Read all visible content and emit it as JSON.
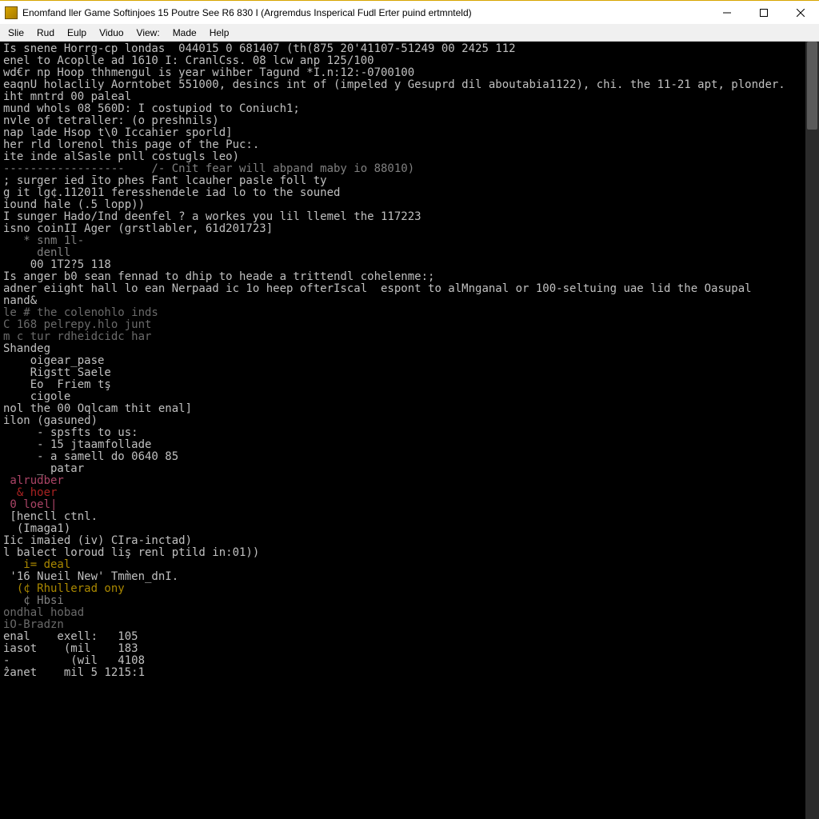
{
  "window": {
    "title": "Enomfand ller Game Softinjoes 15 Poutre See R6 830 I  (Argremdus Insperical Fudl Erter puind ertmnteld)"
  },
  "menu": {
    "items": [
      "Slie",
      "Rud",
      "Eulp",
      "Viduo",
      "View:",
      "Made",
      "Help"
    ]
  },
  "terminal": {
    "lines": [
      {
        "cls": "c-gray",
        "text": "Is snene Horrg-cp londas  044015 0 681407 (th(875 20'41107-51249 00 2425 112"
      },
      {
        "cls": "c-gray",
        "text": "enel to Acoplle ad 1610 I: CranlCss. 08 lcw anp 125/100"
      },
      {
        "cls": "c-gray",
        "text": "wd€r np Hoop thhmengul is year wihber Tagund *I.n:12:-0700100"
      },
      {
        "cls": "c-gray",
        "text": "eaqnU holaclily Aorntobet 551000, desincs int of (impeled y Gesuprd dil aboutabia1122), chi. the 11-21 apt, plonder."
      },
      {
        "cls": "c-gray",
        "text": ""
      },
      {
        "cls": "c-gray",
        "text": "iht mntrd 00 paleal"
      },
      {
        "cls": "c-gray",
        "text": "mund whols 08 560D: I costupiod to Coniuch1;"
      },
      {
        "cls": "c-gray",
        "text": "nvle of tetraller: (o preshnils)"
      },
      {
        "cls": "c-gray",
        "text": "nap lade Hsop t\\0 Iccahier sporld]"
      },
      {
        "cls": "c-gray",
        "text": "her rld lorenol this page of the Puc:."
      },
      {
        "cls": "c-gray",
        "text": ""
      },
      {
        "cls": "c-gray",
        "text": "ite inde alSasle pnll costugls leo)"
      },
      {
        "cls": "c-dim",
        "text": "------------------    /- Cnit fear will abpand maby io 88010)"
      },
      {
        "cls": "c-gray",
        "text": "; surger ied īto phes Fant lcauher pasle foll ty"
      },
      {
        "cls": "c-gray",
        "text": "g it lg¢.112011 feresshendele iad lo to the souned"
      },
      {
        "cls": "c-gray",
        "text": "iound hale (.5 lopp))"
      },
      {
        "cls": "c-gray",
        "text": "I sunger Hado/Ind deenfel ? a workes you lil llemel the 117223"
      },
      {
        "cls": "c-gray",
        "text": "isno coinII Ager (grstlabler, 61d201723]"
      },
      {
        "cls": "c-dim",
        "text": "   * snm 1l-"
      },
      {
        "cls": "c-dim",
        "text": "     denll"
      },
      {
        "cls": "c-gray",
        "text": "    00 1T2?5 118"
      },
      {
        "cls": "c-gray",
        "text": ""
      },
      {
        "cls": "c-gray",
        "text": ""
      },
      {
        "cls": "c-gray",
        "text": "Is anger b0 sean fennad to dhip to heade a trittendl cohelenme:;"
      },
      {
        "cls": "c-gray",
        "text": "adner eiight hall lo ean Nerpaad ic 1o heep ofterIscal  espont to alMnganal or 100-seltuing uae lid the Oasupal"
      },
      {
        "cls": "c-gray",
        "text": ""
      },
      {
        "cls": "c-gray",
        "text": "nand&"
      },
      {
        "cls": "c-gray",
        "text": ""
      },
      {
        "cls": "c-gray",
        "text": ""
      },
      {
        "cls": "c-cmt",
        "text": "le # the colenohlo inds"
      },
      {
        "cls": "c-cmt",
        "text": "C 168 pelrepy.hlo junt"
      },
      {
        "cls": "c-cmt",
        "text": "m c tur rdheidcidc har"
      },
      {
        "cls": "c-gray",
        "text": "Shandeg"
      },
      {
        "cls": "c-gray",
        "text": "    oigear_pase"
      },
      {
        "cls": "c-gray",
        "text": "    Rigstt Saele"
      },
      {
        "cls": "c-gray",
        "text": "    Eo  Friem tş"
      },
      {
        "cls": "c-gray",
        "text": "    cigole"
      },
      {
        "cls": "c-gray",
        "text": ""
      },
      {
        "cls": "c-gray",
        "text": "nol the 00 Oqlcam thit enal]"
      },
      {
        "cls": "c-gray",
        "text": "ilon (gasuned)"
      },
      {
        "cls": "c-gray",
        "text": "     - spsfts to us:"
      },
      {
        "cls": "c-gray",
        "text": "     - 15 jtaamfollade"
      },
      {
        "cls": "c-gray",
        "text": "     - a samell do 0640 85"
      },
      {
        "cls": "c-gray",
        "text": "     _ patar"
      },
      {
        "cls": "c-gray",
        "text": ""
      },
      {
        "cls": "c-gray",
        "text": ""
      },
      {
        "cls": "c-mag",
        "text": " alrudber"
      },
      {
        "cls": "c-red",
        "text": "  & hoer"
      },
      {
        "cls": "c-mag",
        "text": " 0 loel|"
      },
      {
        "cls": "c-gray",
        "text": " [hencll ctnl."
      },
      {
        "cls": "c-gray",
        "text": "  (Imaga1)"
      },
      {
        "cls": "c-gray",
        "text": "Iic imaied (iv) CIra-inctad)"
      },
      {
        "cls": "c-gray",
        "text": "l balect loroud liş renl ptild in:01))"
      },
      {
        "cls": "c-yel",
        "text": "   i= deal"
      },
      {
        "cls": "c-gray",
        "text": " '16 Nueil New' Tmm̀en_dnI."
      },
      {
        "cls": "c-yel",
        "text": "  (¢ Rhullerad ony"
      },
      {
        "cls": "c-dim",
        "text": "   ¢ Hbsi"
      },
      {
        "cls": "c-cmt",
        "text": "ondhal hobad"
      },
      {
        "cls": "c-cmt",
        "text": "iO-Bradzn"
      },
      {
        "cls": "c-gray",
        "text": ""
      },
      {
        "cls": "c-gray",
        "text": ""
      },
      {
        "cls": "c-gray",
        "text": "enal    exell:   105"
      },
      {
        "cls": "c-gray",
        "text": "iasot    (mil    183"
      },
      {
        "cls": "c-gray",
        "text": "-         (wil   4108"
      },
      {
        "cls": "c-gray",
        "text": "ẑanet    mil 5 1215:1"
      }
    ]
  }
}
